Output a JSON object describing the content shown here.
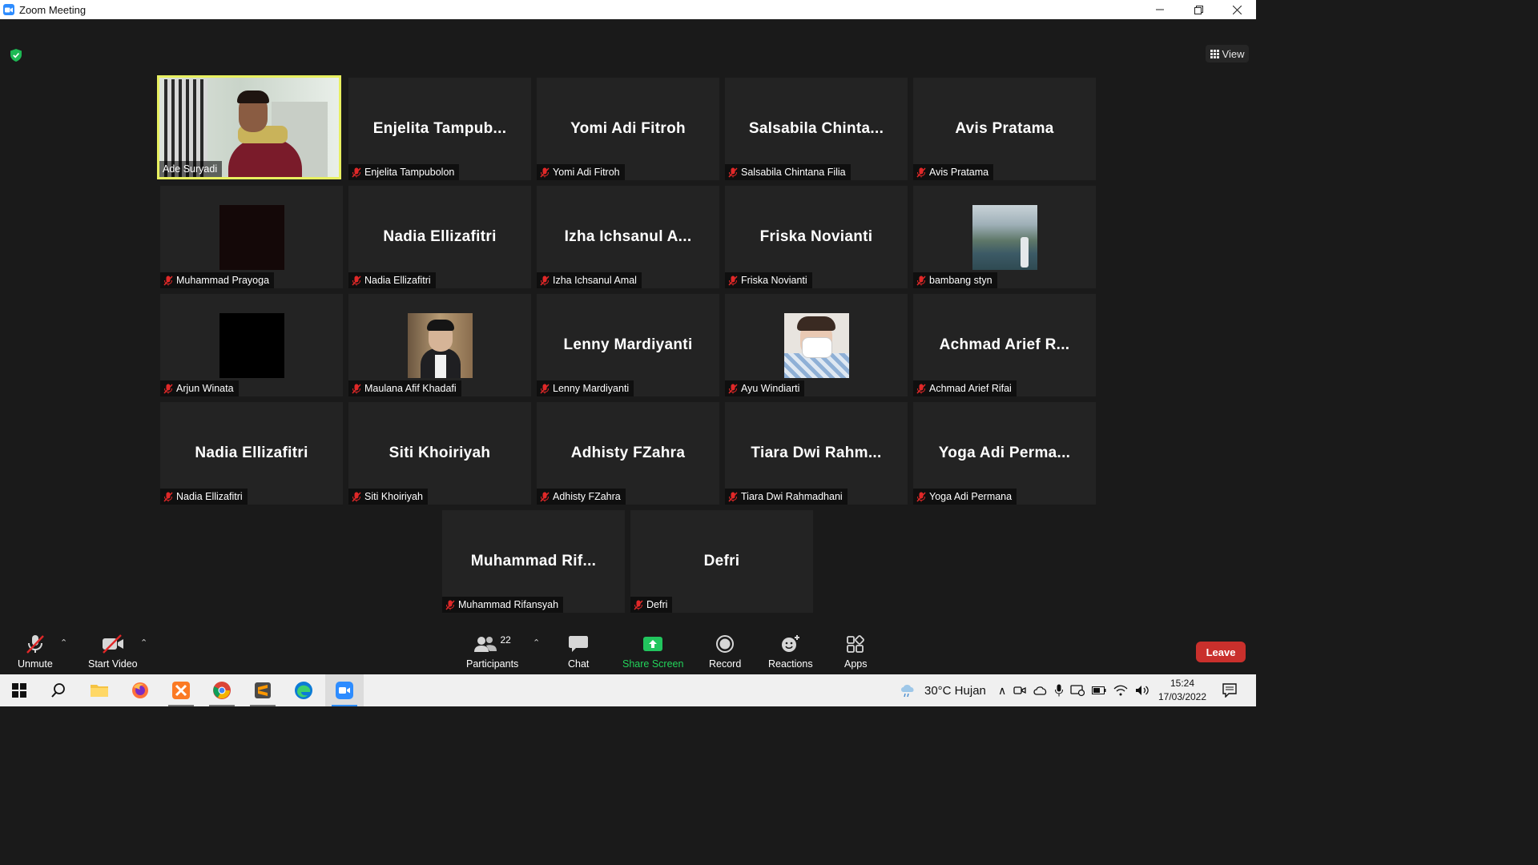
{
  "window": {
    "title": "Zoom Meeting"
  },
  "view_button": "View",
  "participants": [
    {
      "tile_name": "",
      "label": "Ade Suryadi",
      "type": "video"
    },
    {
      "tile_name": "Enjelita  Tampub...",
      "label": "Enjelita Tampubolon",
      "type": "name"
    },
    {
      "tile_name": "Yomi Adi Fitroh",
      "label": "Yomi Adi Fitroh",
      "type": "name"
    },
    {
      "tile_name": "Salsabila  Chinta...",
      "label": "Salsabila Chintana Filia",
      "type": "name"
    },
    {
      "tile_name": "Avis Pratama",
      "label": "Avis Pratama",
      "type": "name"
    },
    {
      "tile_name": "",
      "label": "Muhammad Prayoga",
      "type": "photo-dark"
    },
    {
      "tile_name": "Nadia Ellizafitri",
      "label": "Nadia Ellizafitri",
      "type": "name"
    },
    {
      "tile_name": "Izha  Ichsanul  A...",
      "label": "Izha Ichsanul Amal",
      "type": "name"
    },
    {
      "tile_name": "Friska Novianti",
      "label": "Friska Novianti",
      "type": "name"
    },
    {
      "tile_name": "",
      "label": "bambang styn",
      "type": "photo-landscape"
    },
    {
      "tile_name": "",
      "label": "Arjun Winata",
      "type": "photo-black"
    },
    {
      "tile_name": "",
      "label": "Maulana Afif Khadafi",
      "type": "photo-person"
    },
    {
      "tile_name": "Lenny Mardiyanti",
      "label": "Lenny Mardiyanti",
      "type": "name"
    },
    {
      "tile_name": "",
      "label": "Ayu Windiarti",
      "type": "photo-mask"
    },
    {
      "tile_name": "Achmad  Arief  R...",
      "label": "Achmad Arief Rifai",
      "type": "name"
    },
    {
      "tile_name": "Nadia Ellizafitri",
      "label": "Nadia Ellizafitri",
      "type": "name"
    },
    {
      "tile_name": "Siti Khoiriyah",
      "label": "Siti Khoiriyah",
      "type": "name"
    },
    {
      "tile_name": "Adhisty FZahra",
      "label": "Adhisty FZahra",
      "type": "name"
    },
    {
      "tile_name": "Tiara  Dwi  Rahm...",
      "label": "Tiara Dwi Rahmadhani",
      "type": "name"
    },
    {
      "tile_name": "Yoga  Adi  Perma...",
      "label": "Yoga Adi Permana",
      "type": "name"
    },
    {
      "tile_name": "Muhammad  Rif...",
      "label": "Muhammad Rifansyah",
      "type": "name"
    },
    {
      "tile_name": "Defri",
      "label": "Defri",
      "type": "name"
    }
  ],
  "toolbar": {
    "unmute": "Unmute",
    "start_video": "Start Video",
    "participants": "Participants",
    "participants_count": "22",
    "chat": "Chat",
    "share_screen": "Share Screen",
    "record": "Record",
    "reactions": "Reactions",
    "apps": "Apps",
    "leave": "Leave"
  },
  "taskbar": {
    "weather": "30°C  Hujan",
    "time": "15:24",
    "date": "17/03/2022"
  },
  "colors": {
    "accent_green": "#22d35a",
    "leave_red": "#c9302c",
    "active_speaker": "#e8f060"
  }
}
